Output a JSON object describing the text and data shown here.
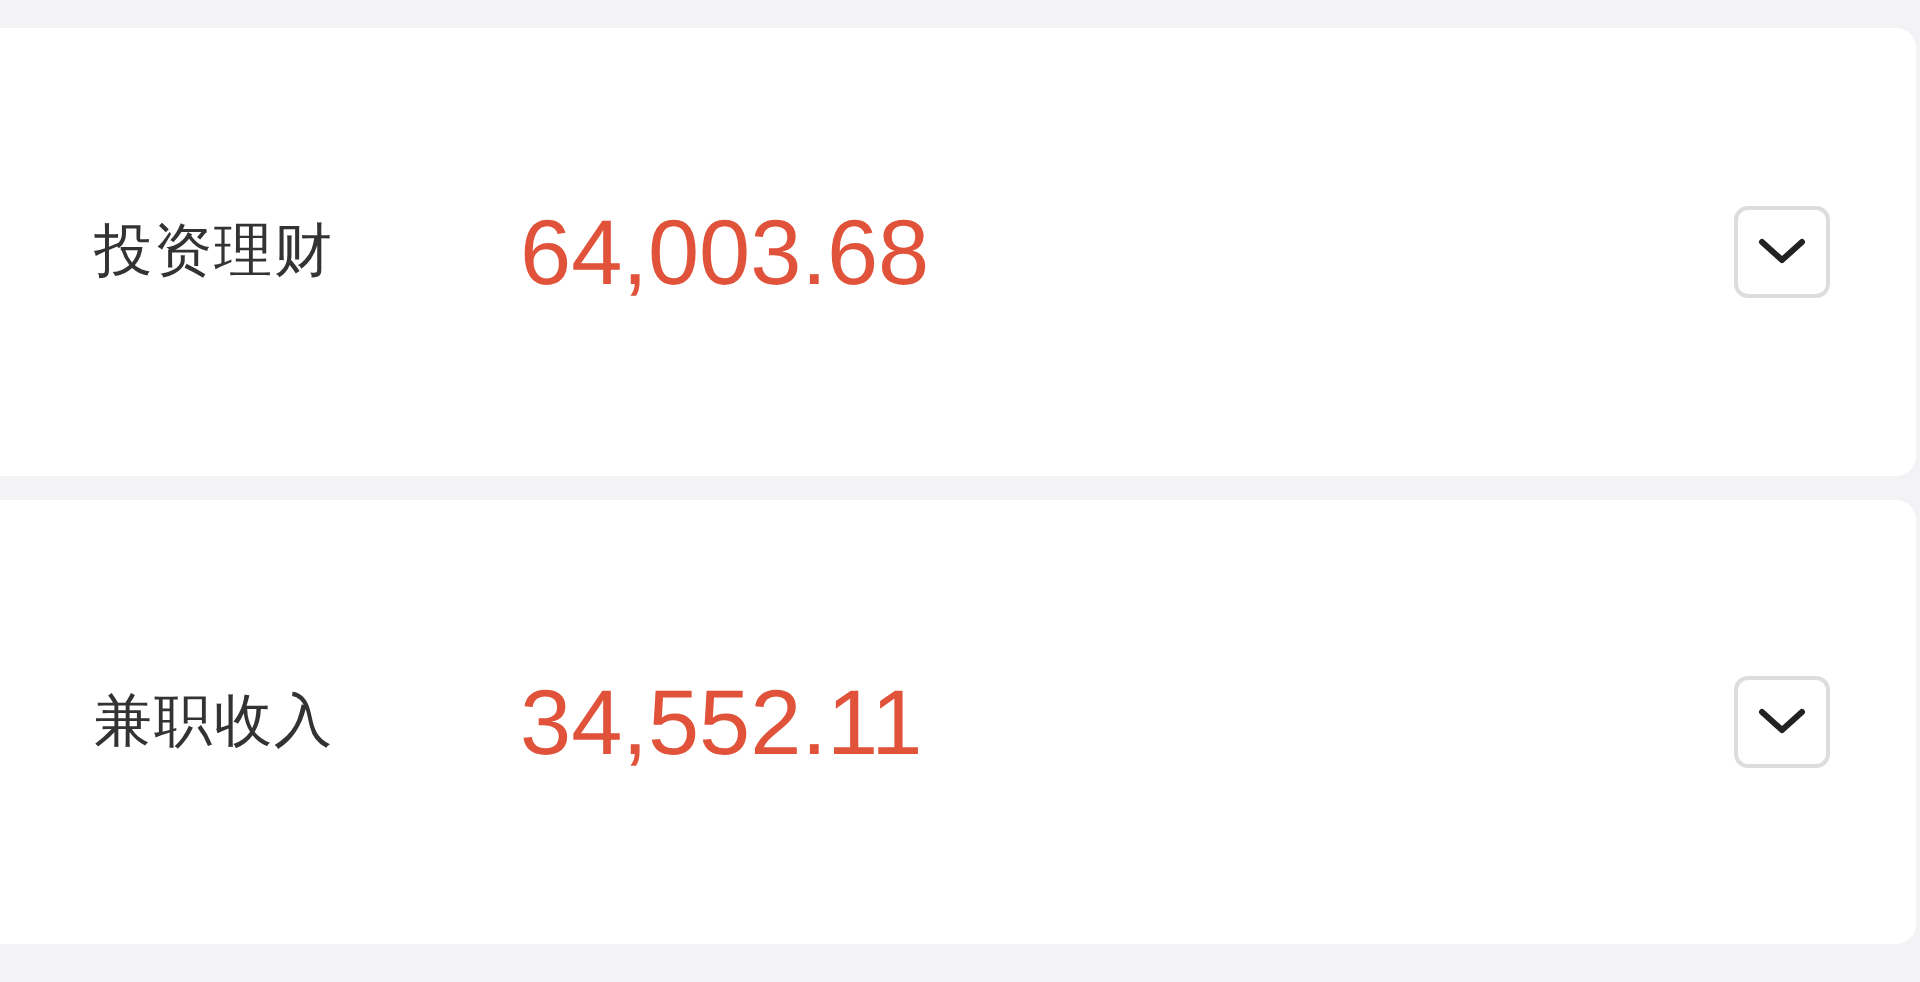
{
  "rows": [
    {
      "label": "投资理财",
      "amount": "64,003.68"
    },
    {
      "label": "兼职收入",
      "amount": "34,552.11"
    }
  ]
}
